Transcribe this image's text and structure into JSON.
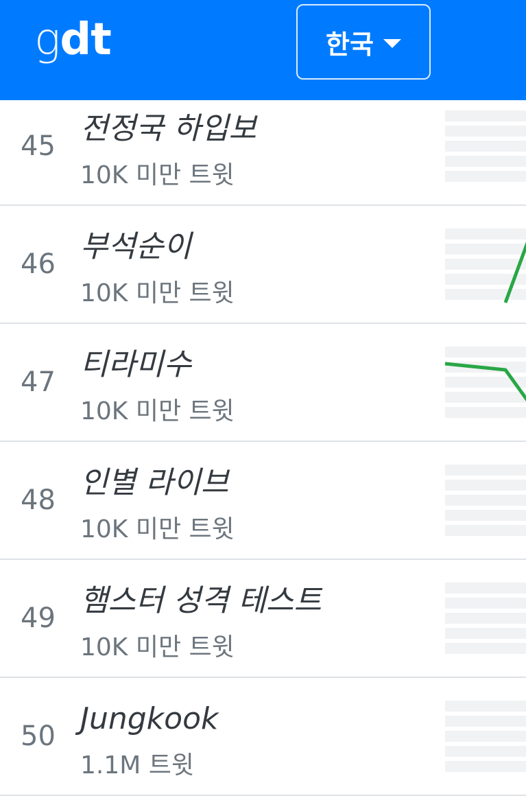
{
  "header": {
    "logo_light": "g",
    "logo_bold": "dt",
    "language_label": "한국"
  },
  "trends": [
    {
      "rank": "45",
      "title": "전정국 하입보",
      "tweets": "10K 미만 트윗"
    },
    {
      "rank": "46",
      "title": "부석순이",
      "tweets": "10K 미만 트윗"
    },
    {
      "rank": "47",
      "title": "티라미수",
      "tweets": "10K 미만 트윗"
    },
    {
      "rank": "48",
      "title": "인별 라이브",
      "tweets": "10K 미만 트윗"
    },
    {
      "rank": "49",
      "title": "햄스터 성격 테스트",
      "tweets": "10K 미만 트윗"
    },
    {
      "rank": "50",
      "title": "Jungkook",
      "tweets": "1.1M 트윗"
    }
  ],
  "colors": {
    "header_bg": "#007bff",
    "sparkline": "#28a745",
    "rank_text": "#6c757d"
  }
}
